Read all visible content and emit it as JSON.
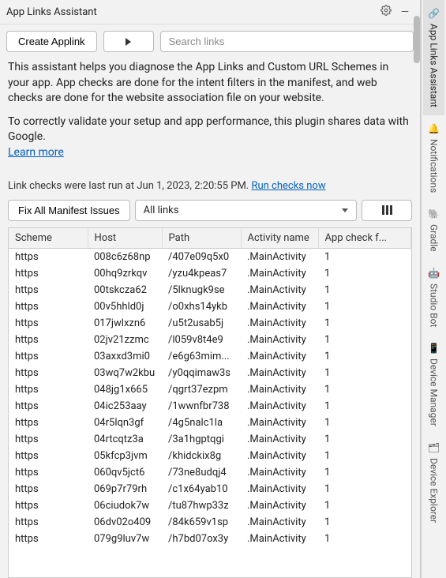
{
  "titlebar": {
    "title": "App Links Assistant"
  },
  "toolbar": {
    "create_label": "Create Applink",
    "search_placeholder": "Search links"
  },
  "description": {
    "p1": "This assistant helps you diagnose the App Links and Custom URL Schemes in your app. App checks are done for the intent filters in the manifest, and web checks are done for the website association file on your website.",
    "p2": "To correctly validate your setup and app performance, this plugin shares data with Google.",
    "learn_more": "Learn more"
  },
  "status": {
    "text": "Link checks were last run at Jun 1, 2023, 2:20:55 PM.  ",
    "run_link": "Run checks now"
  },
  "controls": {
    "fix_label": "Fix All Manifest Issues",
    "dropdown_value": "All links"
  },
  "table": {
    "headers": {
      "scheme": "Scheme",
      "host": "Host",
      "path": "Path",
      "activity": "Activity name",
      "appcheck": "App check f..."
    },
    "rows": [
      {
        "scheme": "https",
        "host": "008c6z68np",
        "path": "/407e09q5x0",
        "activity": ".MainActivity",
        "app": "1"
      },
      {
        "scheme": "https",
        "host": "00hq9zrkqv",
        "path": "/yzu4kpeas7",
        "activity": ".MainActivity",
        "app": "1"
      },
      {
        "scheme": "https",
        "host": "00tskcza62",
        "path": "/5lknugk9se",
        "activity": ".MainActivity",
        "app": "1"
      },
      {
        "scheme": "https",
        "host": "00v5hhld0j",
        "path": "/o0xhs14ykb",
        "activity": ".MainActivity",
        "app": "1"
      },
      {
        "scheme": "https",
        "host": "017jwlxzn6",
        "path": "/u5t2usab5j",
        "activity": ".MainActivity",
        "app": "1"
      },
      {
        "scheme": "https",
        "host": "02jv21zzmc",
        "path": "/l059v8t4e9",
        "activity": ".MainActivity",
        "app": "1"
      },
      {
        "scheme": "https",
        "host": "03axxd3mi0",
        "path": "/e6g63mim...",
        "activity": ".MainActivity",
        "app": "1"
      },
      {
        "scheme": "https",
        "host": "03wq7w2kbu",
        "path": "/y0qqimaw3s",
        "activity": ".MainActivity",
        "app": "1"
      },
      {
        "scheme": "https",
        "host": "048jg1x665",
        "path": "/qgrt37ezpm",
        "activity": ".MainActivity",
        "app": "1"
      },
      {
        "scheme": "https",
        "host": "04ic253aay",
        "path": "/1wwnfbr738",
        "activity": ".MainActivity",
        "app": "1"
      },
      {
        "scheme": "https",
        "host": "04r5lqn3gf",
        "path": "/4g5nalc1la",
        "activity": ".MainActivity",
        "app": "1"
      },
      {
        "scheme": "https",
        "host": "04rtcqtz3a",
        "path": "/3a1hgptqgi",
        "activity": ".MainActivity",
        "app": "1"
      },
      {
        "scheme": "https",
        "host": "05kfcp3jvm",
        "path": "/khidckix8g",
        "activity": ".MainActivity",
        "app": "1"
      },
      {
        "scheme": "https",
        "host": "060qv5jct6",
        "path": "/73ne8udqj4",
        "activity": ".MainActivity",
        "app": "1"
      },
      {
        "scheme": "https",
        "host": "069p7r79rh",
        "path": "/c1x64yab10",
        "activity": ".MainActivity",
        "app": "1"
      },
      {
        "scheme": "https",
        "host": "06ciudok7w",
        "path": "/tu87hwp33z",
        "activity": ".MainActivity",
        "app": "1"
      },
      {
        "scheme": "https",
        "host": "06dv02o409",
        "path": "/84k659v1sp",
        "activity": ".MainActivity",
        "app": "1"
      },
      {
        "scheme": "https",
        "host": "079g9luv7w",
        "path": "/h7bd07ox3y",
        "activity": ".MainActivity",
        "app": "1"
      }
    ]
  },
  "right_tabs": {
    "t1": "App Links Assistant",
    "t2": "Notifications",
    "t3": "Gradle",
    "t4": "Studio Bot",
    "t5": "Device Manager",
    "t6": "Device Explorer"
  }
}
